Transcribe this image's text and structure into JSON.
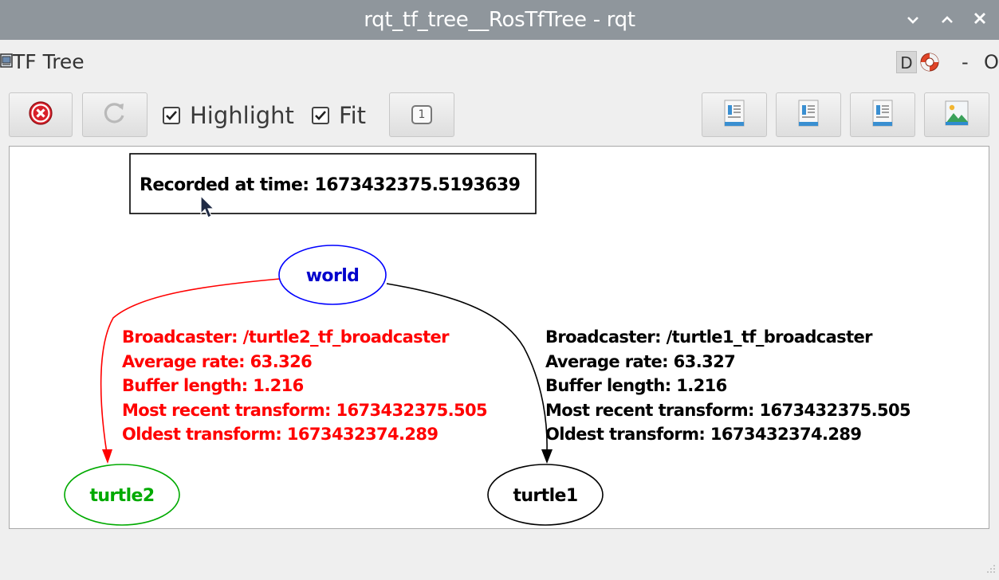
{
  "window": {
    "title": "rqt_tf_tree__RosTfTree - rqt"
  },
  "plugin": {
    "title": "TF Tree",
    "ctrl_d": "D",
    "ctrl_minus": "-",
    "ctrl_o": "O"
  },
  "toolbar": {
    "highlight_label": "Highlight",
    "highlight_checked": true,
    "fit_label": "Fit",
    "fit_checked": true,
    "one_label": "1"
  },
  "graph": {
    "recorded_label": "Recorded at time: 1673432375.5193639",
    "nodes": {
      "world": "world",
      "turtle2": "turtle2",
      "turtle1": "turtle1"
    },
    "edge_turtle2": {
      "broadcaster": "Broadcaster: /turtle2_tf_broadcaster",
      "average_rate": "Average rate: 63.326",
      "buffer_length": "Buffer length: 1.216",
      "most_recent": "Most recent transform: 1673432375.505",
      "oldest": "Oldest transform: 1673432374.289"
    },
    "edge_turtle1": {
      "broadcaster": "Broadcaster: /turtle1_tf_broadcaster",
      "average_rate": "Average rate: 63.327",
      "buffer_length": "Buffer length: 1.216",
      "most_recent": "Most recent transform: 1673432375.505",
      "oldest": "Oldest transform: 1673432374.289"
    }
  },
  "colors": {
    "titlebar": "#8f969c",
    "world": "#0000ff",
    "world_text": "#0000cc",
    "turtle2": "#00aa00",
    "turtle1": "#000000",
    "edge_highlight": "#ff0000",
    "edge_normal": "#000000"
  }
}
